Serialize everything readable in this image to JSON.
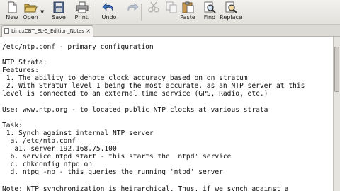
{
  "toolbar": {
    "new": "New",
    "open": "Open",
    "save": "Save",
    "print": "Print.",
    "undo": "Undo",
    "paste": "Paste",
    "find": "Find",
    "replace": "Replace"
  },
  "tab": {
    "label": "LinuxCBT_EL-5_Edition_Notes",
    "close": "×"
  },
  "editor": {
    "lines": [
      "/etc/ntp.conf - primary configuration",
      "",
      "NTP Strata:",
      "Features:",
      " 1. The ability to denote clock accuracy based on on stratum",
      " 2. With Stratum level 1 being the most accurate, as an NTP server at this",
      "level is connected to an external time service (GPS, Radio, etc.)",
      "",
      "Use: www.ntp.org - to located public NTP clocks at various strata",
      "",
      "Task:",
      " 1. Synch against internal NTP server",
      "  a. /etc/ntp.conf",
      "   a1. server 192.168.75.100",
      "  b. service ntpd start - this starts the 'ntpd' service",
      "  c. chkconfig ntpd on",
      "  d. ntpq -np - this queries the running 'ntpd' server",
      "",
      "Note: NTP synchronization is heirarchical. Thus, if we synch against a"
    ]
  },
  "colors": {
    "toolbar_bg": "#ecebe8",
    "editor_bg": "#ffffff",
    "text": "#111111"
  }
}
